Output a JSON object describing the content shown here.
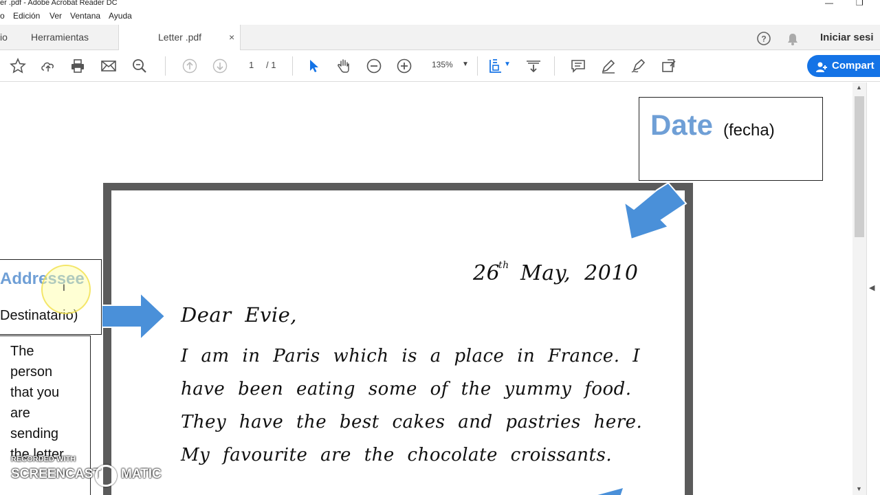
{
  "window": {
    "title": "er .pdf - Adobe Acrobat Reader DC"
  },
  "menu": {
    "items": [
      "o",
      "Edición",
      "Ver",
      "Ventana",
      "Ayuda"
    ]
  },
  "tabs": {
    "home_fragment": "io",
    "tools": "Herramientas",
    "document": "Letter .pdf",
    "close_symbol": "×"
  },
  "header_right": {
    "signin": "Iniciar sesi"
  },
  "toolbar": {
    "page_current": "1",
    "page_total": "/ 1",
    "zoom": "135%",
    "share_label": "Compart"
  },
  "document": {
    "date_label": "Date",
    "date_translation": "(fecha)",
    "addressee_label": "Addressee",
    "addressee_translation": "Destinatario)",
    "description_lines": [
      "The",
      "person",
      "that you",
      "are",
      "sending",
      "the letter"
    ],
    "letter": {
      "date_day": "26",
      "date_suffix": "th",
      "date_rest": "May, 2010",
      "greeting": "Dear Evie,",
      "body": [
        "I am in Paris which is a place in France. I",
        "have been eating some of the yummy food.",
        "They have the best cakes and pastries here.",
        "My favourite are the chocolate croissants."
      ]
    }
  },
  "watermark": {
    "line1": "RECORDED WITH",
    "line2_a": "SCREENCAST",
    "line2_b": "MATIC"
  },
  "colors": {
    "accent_blue": "#1473e6",
    "label_blue": "#6f9fd6",
    "arrow_blue": "#4a90d9"
  }
}
